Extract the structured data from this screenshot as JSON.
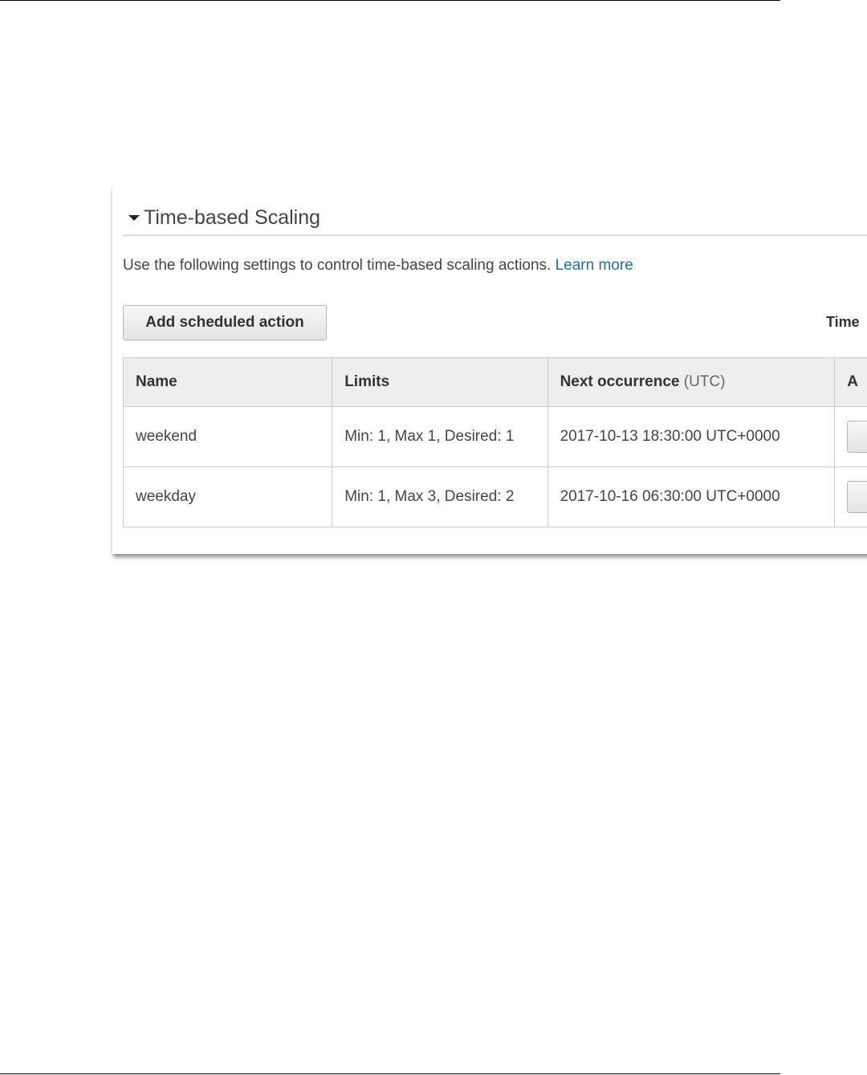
{
  "section": {
    "title": "Time-based Scaling",
    "description": "Use the following settings to control time-based scaling actions.",
    "learn_more": "Learn more"
  },
  "toolbar": {
    "add_button_label": "Add scheduled action",
    "timezone_label": "Time"
  },
  "table": {
    "columns": [
      {
        "label": "Name",
        "suffix": ""
      },
      {
        "label": "Limits",
        "suffix": ""
      },
      {
        "label": "Next occurrence",
        "suffix": "(UTC)"
      },
      {
        "label": "A",
        "suffix": ""
      }
    ],
    "rows": [
      {
        "name": "weekend",
        "limits": "Min: 1, Max 1, Desired: 1",
        "next_occurrence": "2017-10-13 18:30:00 UTC+0000"
      },
      {
        "name": "weekday",
        "limits": "Min: 1, Max 3, Desired: 2",
        "next_occurrence": "2017-10-16 06:30:00 UTC+0000"
      }
    ]
  },
  "colors": {
    "link": "#1a6dbb",
    "header_bg": "#eeeeee",
    "border": "#cccccc"
  },
  "icons": {
    "section_toggle": "caret-down-icon"
  }
}
